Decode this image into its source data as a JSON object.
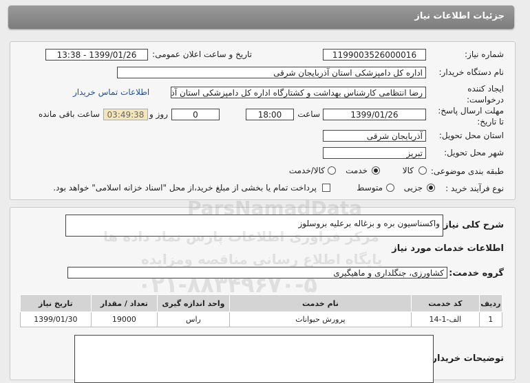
{
  "page_title": "جزئیات اطلاعات نیاز",
  "fields": {
    "need_number_label": "شماره نیاز:",
    "need_number": "1199003526000016",
    "announce_label": "تاریخ و ساعت اعلان عمومی:",
    "announce_value": "1399/01/26 - 13:38",
    "buyer_org_label": "نام دستگاه خریدار:",
    "buyer_org": "اداره کل دامپزشکی استان آذربایجان شرقی",
    "creator_label_1": "ایجاد کننده",
    "creator_label_2": "درخواست:",
    "creator": "رضا انتظامی کارشناس بهداشت و کشتارگاه اداره کل دامپزشکی استان آذربایجان شرقی",
    "contact_link": "اطلاعات تماس خریدار",
    "deadline_label_1": "مهلت ارسال پاسخ:",
    "deadline_label_2": "تا تاریخ:",
    "deadline_date": "1399/01/26",
    "time_label": "ساعت",
    "deadline_time": "18:00",
    "days_value": "0",
    "days_label": "روز و",
    "remaining_time": "03:49:38",
    "remaining_label": "ساعت باقی مانده",
    "province_label": "استان محل تحویل:",
    "province": "آذربایجان شرقی",
    "city_label": "شهر محل تحویل:",
    "city": "تبریز",
    "category_label": "طبقه بندی موضوعی:",
    "category_options": [
      "کالا",
      "خدمت",
      "کالا/خدمت"
    ],
    "category_selected": "خدمت",
    "process_label": "نوع فرآیند خرید :",
    "process_options": [
      "جزیی",
      "متوسط"
    ],
    "process_selected": "جزیی",
    "payment_note": "پرداخت تمام یا بخشی از مبلغ خرید،از محل \"اسناد خزانه اسلامی\" خواهد بود."
  },
  "summary": {
    "label": "شرح کلی نیاز:",
    "value": "واکسناسیون بره و بزغاله برعلیه بروسلوز"
  },
  "services": {
    "section_title": "اطلاعات خدمات مورد نیاز",
    "group_label": "گروه خدمت:",
    "group_value": "کشاورزی، جنگلداری و ماهیگیری",
    "headers": [
      "ردیف",
      "کد خدمت",
      "نام خدمت",
      "واحد اندازه گیری",
      "تعداد / مقدار",
      "تاریخ نیاز"
    ],
    "rows": [
      [
        "1",
        "الف-1-14",
        "پرورش حیوانات",
        "راس",
        "19000",
        "1399/01/30"
      ]
    ]
  },
  "buyer_notes_label": "توضیحات خریدار:",
  "watermark": {
    "line1": "ParsNamadData",
    "line2": "مرکز فراوری اطلاعات پارس نماد داده ها",
    "line3": "پایگاه اطلاع رسانی مناقصه ومزایده",
    "line4": "۰۲۱-۸۸۳۴۹۶۷۰-۵"
  }
}
